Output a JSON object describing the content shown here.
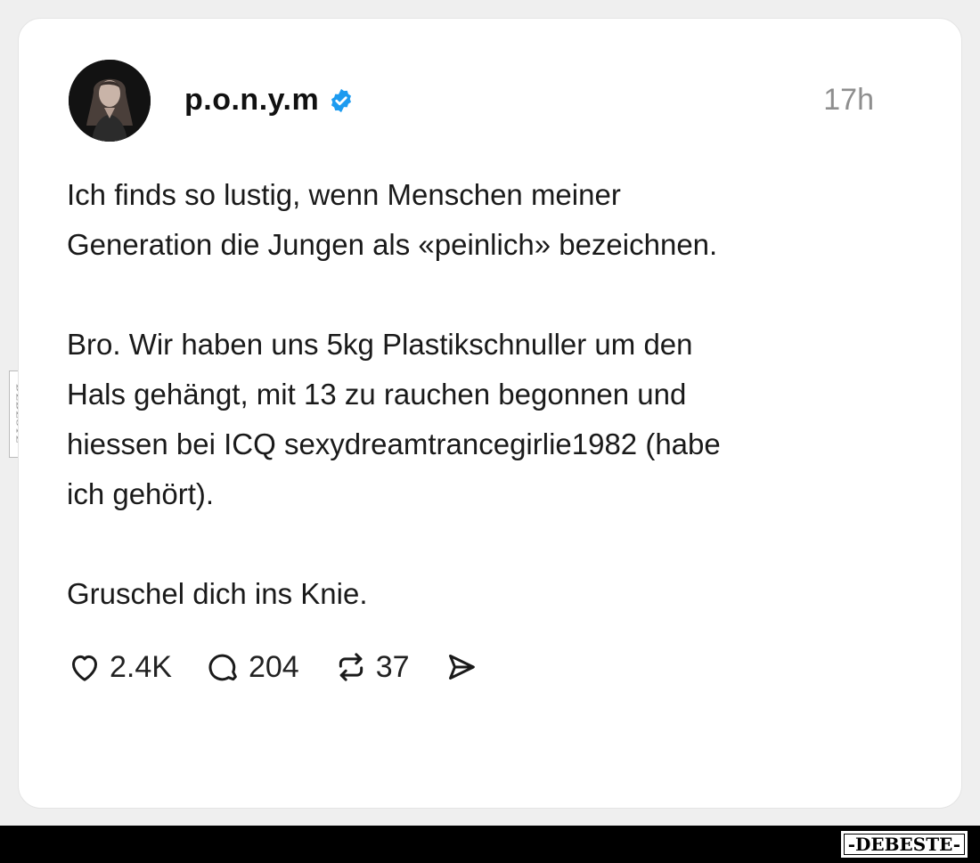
{
  "post": {
    "username": "p.o.n.y.m",
    "verified_icon": "verified-badge-icon",
    "timestamp": "17h",
    "paragraphs": [
      "Ich finds so lustig, wenn Menschen meiner\nGeneration die Jungen als «peinlich» bezeichnen.",
      "Bro. Wir haben uns 5kg Plastikschnuller um den\nHals gehängt, mit 13 zu rauchen begonnen und\nhiessen bei ICQ sexydreamtrancegirlie1982 (habe\nich gehört).",
      "Gruschel dich ins Knie."
    ]
  },
  "actions": {
    "likes": "2.4K",
    "comments": "204",
    "reposts": "37"
  },
  "watermark": {
    "side_text": "DEBESTE",
    "footer_text": "-DEBESTE-"
  },
  "colors": {
    "verified": "#1d9bf0",
    "background": "#efefef",
    "card": "#ffffff",
    "text": "#1a1a1a",
    "muted": "#8e8e8e"
  }
}
